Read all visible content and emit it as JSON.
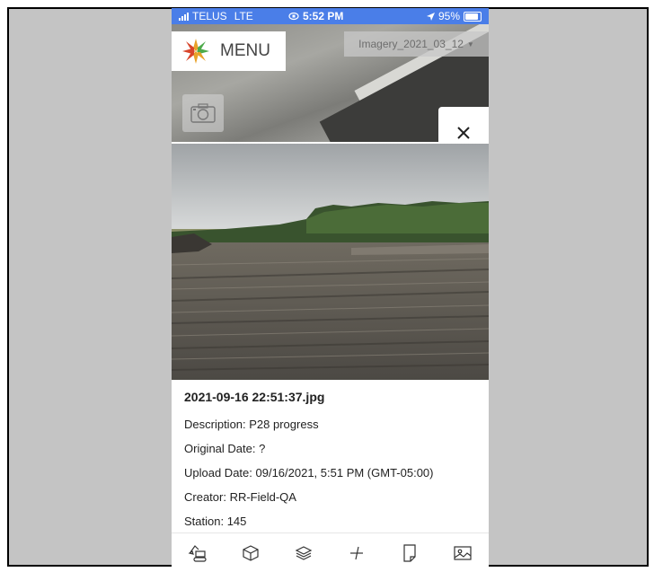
{
  "status_bar": {
    "carrier": "TELUS",
    "network": "LTE",
    "time": "5:52 PM",
    "battery": "95%"
  },
  "header": {
    "menu_label": "MENU",
    "imagery_selected": "Imagery_2021_03_12"
  },
  "photo_details": {
    "filename": "2021-09-16 22:51:37.jpg",
    "description": "Description: P28 progress",
    "original_date": "Original Date: ?",
    "upload_date": "Upload Date: 09/16/2021, 5:51 PM (GMT-05:00)",
    "creator": "Creator: RR-Field-QA",
    "station": "Station: 145"
  },
  "toolbar": {
    "icons": [
      "excavator-icon",
      "cube-icon",
      "layers-icon",
      "measure-icon",
      "note-icon",
      "image-icon"
    ]
  },
  "colors": {
    "status_bar": "#4a7ee8",
    "frame_background": "#c4c4c4"
  }
}
